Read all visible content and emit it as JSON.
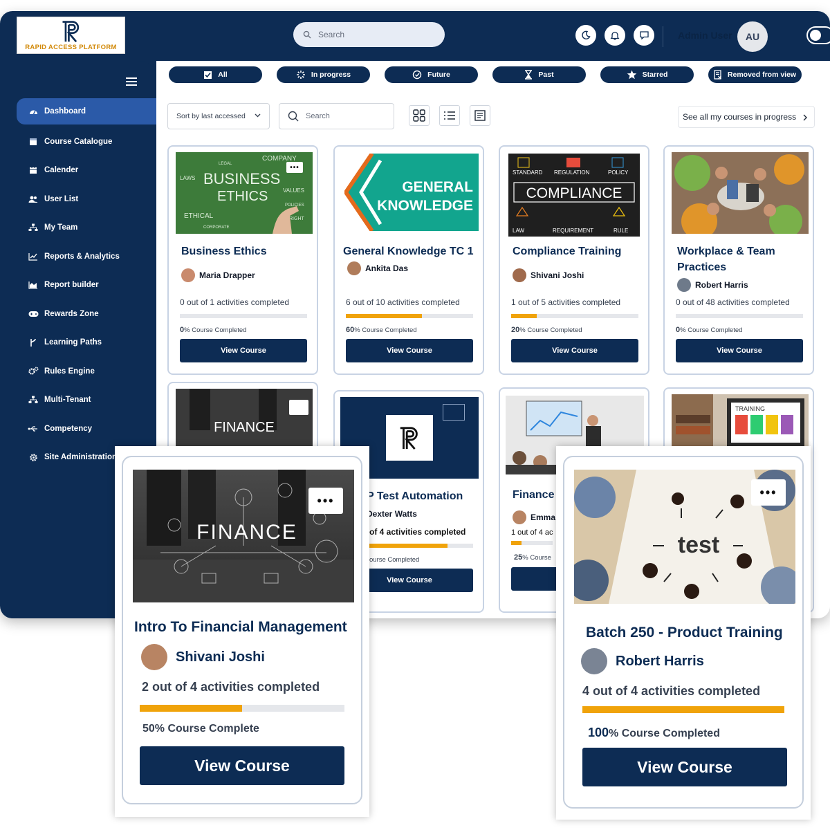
{
  "brand": {
    "logo_text": "RAPID ACCESS PLATFORM"
  },
  "header": {
    "search_placeholder": "Search",
    "user_name": "Admin User",
    "user_initials": "AU"
  },
  "sidebar": {
    "items": [
      {
        "label": "Dashboard",
        "icon": "dashboard-icon"
      },
      {
        "label": "Course Catalogue",
        "icon": "catalogue-icon"
      },
      {
        "label": "Calender",
        "icon": "calendar-icon"
      },
      {
        "label": "User List",
        "icon": "users-icon"
      },
      {
        "label": "My Team",
        "icon": "team-icon"
      },
      {
        "label": "Reports & Analytics",
        "icon": "chart-icon"
      },
      {
        "label": "Report builder",
        "icon": "area-chart-icon"
      },
      {
        "label": "Rewards Zone",
        "icon": "gamepad-icon"
      },
      {
        "label": "Learning Paths",
        "icon": "path-icon"
      },
      {
        "label": "Rules Engine",
        "icon": "cogs-icon"
      },
      {
        "label": "Multi-Tenant",
        "icon": "tenant-icon"
      },
      {
        "label": "Competency",
        "icon": "usb-icon"
      },
      {
        "label": "Site Administration",
        "icon": "gear-icon"
      }
    ]
  },
  "filters": [
    "All",
    "In progress",
    "Future",
    "Past",
    "Starred",
    "Removed from view"
  ],
  "toolbar": {
    "sort_label": "Sort by last accessed",
    "search_placeholder": "Search",
    "see_all": "See all my courses in progress"
  },
  "courses": [
    {
      "title": "Business Ethics",
      "instructor": "Maria Drapper",
      "activities": "0 out of 1 activities completed",
      "percent_value": "0",
      "percent_label": "% Course Completed",
      "button": "View Course",
      "progress": 0
    },
    {
      "title": "General Knowledge TC 1",
      "instructor": "Ankita Das",
      "activities": "6 out of 10 activities completed",
      "percent_value": "60",
      "percent_label": "% Course Completed",
      "button": "View Course",
      "progress": 60,
      "thumb_line1": "GENERAL",
      "thumb_line2": "KNOWLEDGE"
    },
    {
      "title": "Compliance Training",
      "instructor": "Shivani Joshi",
      "activities": "1 out of 5 activities completed",
      "percent_value": "20",
      "percent_label": "% Course Completed",
      "button": "View Course",
      "progress": 20,
      "thumb_text": "COMPLIANCE",
      "thumb_words": [
        "STANDARD",
        "REGULATION",
        "POLICY",
        "LAW",
        "REQUIREMENT",
        "RULE"
      ]
    },
    {
      "title": "Workplace & Team Practices",
      "instructor": "Robert Harris",
      "activities": "0 out of 48 activities completed",
      "percent_value": "0",
      "percent_label": "% Course Completed",
      "button": "View Course",
      "progress": 0
    }
  ],
  "business_thumb_words": [
    "BUSINESS",
    "ETHICS",
    "COMPANY",
    "LAWS",
    "VALUES",
    "ETHICAL",
    "RIGHT",
    "POLICIES",
    "LEGAL",
    "CORPORATE"
  ],
  "row2": [
    {
      "thumb_text": "FINANCE"
    },
    {
      "title_partial": "P Test Automation",
      "instructor_partial": "Dexter Watts",
      "activities_partial": "of 4 activities completed",
      "percent_partial": "ourse Completed",
      "button": "View Course",
      "progress": 75
    },
    {
      "title_partial": "Finance",
      "instructor_partial": "Emma",
      "activities_partial": "1 out of 4 ac",
      "percent_value": "25",
      "percent_label": "% Course",
      "progress": 25
    },
    {
      "thumb_text": "TRAINING"
    }
  ],
  "featured": [
    {
      "title": "Intro To Financial Management",
      "instructor": "Shivani Joshi",
      "activities": "2 out of 4 activities completed",
      "percent_text": "50% Course Complete",
      "button": "View Course",
      "progress": 50,
      "thumb_text": "FINANCE"
    },
    {
      "title": "Batch 250 - Product Training",
      "instructor": "Robert Harris",
      "activities": "4 out of 4 activities completed",
      "percent_value": "100",
      "percent_label": "% Course Completed",
      "button": "View Course",
      "progress": 100,
      "thumb_text": "test"
    }
  ],
  "colors": {
    "navy": "#0d2c54",
    "accent": "#f0a30a",
    "active": "#2b5aa8"
  }
}
